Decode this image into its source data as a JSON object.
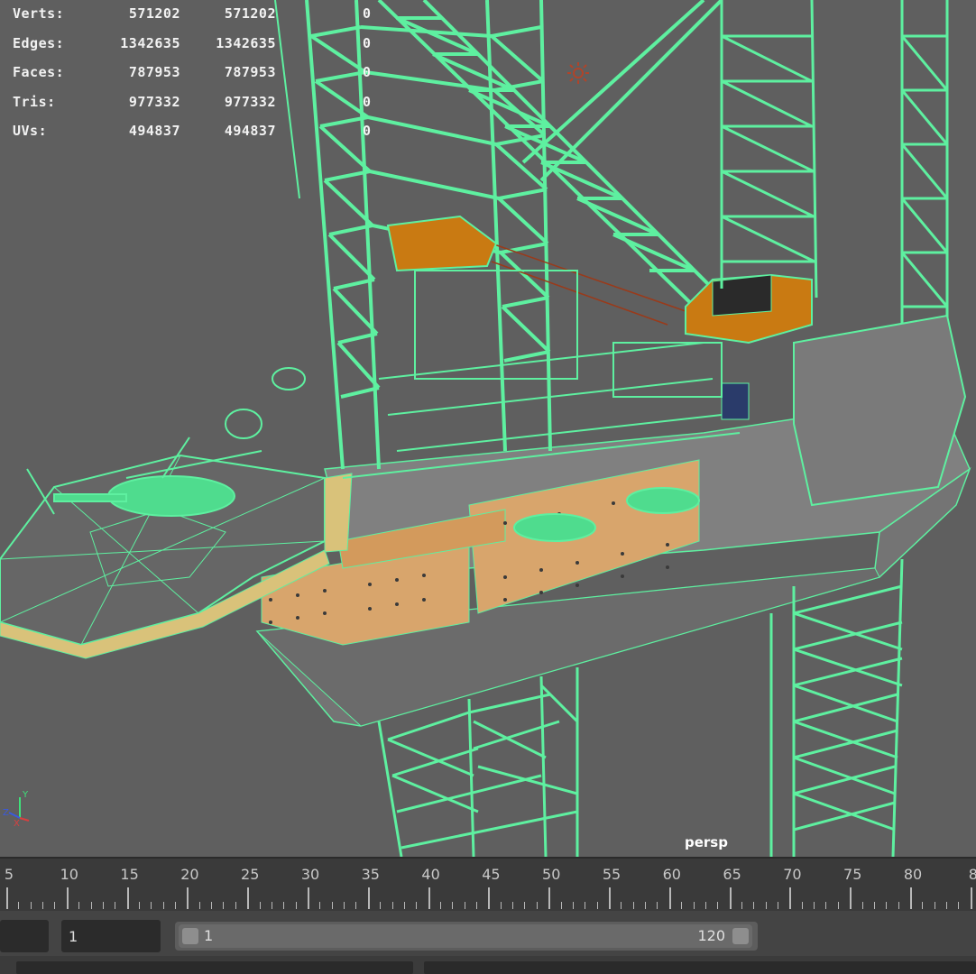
{
  "colors": {
    "viewport_bg": "#5f5f5f",
    "wireframe": "#5ef0a0",
    "deck_orange": "#d9a46a",
    "crane_orange": "#c97a12",
    "hull_grey": "#7a7a7a",
    "timeline_bg": "#3a3a3a"
  },
  "hud": {
    "rows": [
      {
        "label": "Verts:",
        "total": "571202",
        "selected": "571202",
        "extra": "0"
      },
      {
        "label": "Edges:",
        "total": "1342635",
        "selected": "1342635",
        "extra": "0"
      },
      {
        "label": "Faces:",
        "total": "787953",
        "selected": "787953",
        "extra": "0"
      },
      {
        "label": "Tris:",
        "total": "977332",
        "selected": "977332",
        "extra": "0"
      },
      {
        "label": "UVs:",
        "total": "494837",
        "selected": "494837",
        "extra": "0"
      }
    ]
  },
  "viewport": {
    "camera_label": "persp",
    "light_icon": "sun-light-icon",
    "axis_icon": "axis-gizmo-icon"
  },
  "timeline": {
    "ticks": [
      "5",
      "10",
      "15",
      "20",
      "25",
      "30",
      "35",
      "40",
      "45",
      "50",
      "55",
      "60",
      "65",
      "70",
      "75",
      "80",
      "8"
    ]
  },
  "range": {
    "start_field": "1",
    "range_start": "1",
    "range_end": "120"
  }
}
